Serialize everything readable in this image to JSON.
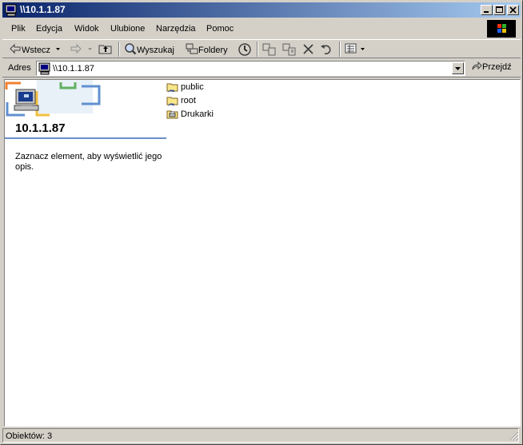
{
  "window": {
    "title": "\\\\10.1.1.87"
  },
  "menu": {
    "file": "Plik",
    "edit": "Edycja",
    "view": "Widok",
    "favorites": "Ulubione",
    "tools": "Narzędzia",
    "help": "Pomoc"
  },
  "toolbar": {
    "back": "Wstecz",
    "search": "Wyszukaj",
    "folders": "Foldery"
  },
  "address": {
    "label": "Adres",
    "value": "\\\\10.1.1.87",
    "go": "Przejdź"
  },
  "panel": {
    "host": "10.1.1.87",
    "description": "Zaznacz element, aby wyświetlić jego opis."
  },
  "items": [
    {
      "name": "public",
      "icon": "shared-folder-icon"
    },
    {
      "name": "root",
      "icon": "shared-folder-icon"
    },
    {
      "name": "Drukarki",
      "icon": "printers-folder-icon"
    }
  ],
  "status": {
    "text": "Obiektów: 3"
  },
  "colors": {
    "titlebar": "#0a246a",
    "titlebar_end": "#a6caf0",
    "face": "#d4d0c8",
    "panel_rule": "#6a8ec8"
  }
}
